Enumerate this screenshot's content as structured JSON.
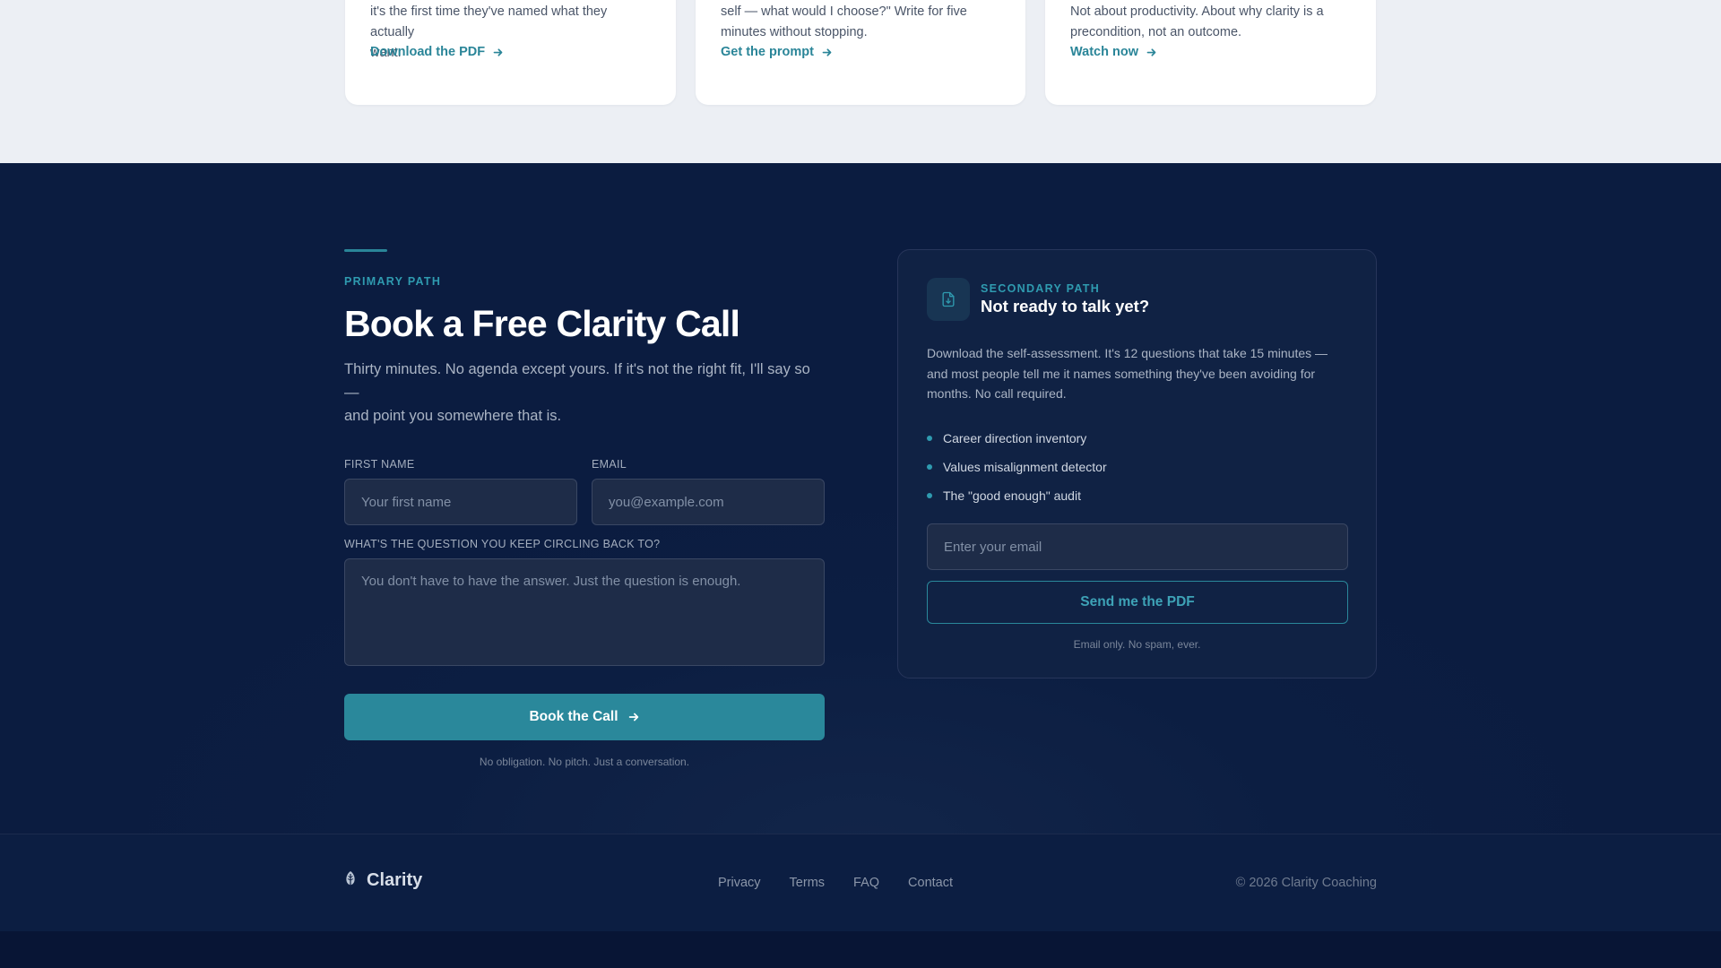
{
  "resources": {
    "cards": [
      {
        "desc_lines": [
          "it's the first time they've named what they actually",
          "want."
        ],
        "link_label": "Download the PDF"
      },
      {
        "desc_lines": [
          "self — what would I choose?\" Write for five",
          "minutes without stopping."
        ],
        "link_label": "Get the prompt"
      },
      {
        "desc_lines": [
          "Not about productivity. About why clarity is a",
          "precondition, not an outcome."
        ],
        "link_label": "Watch now"
      }
    ]
  },
  "primary": {
    "eyebrow": "PRIMARY PATH",
    "headline": "Book a Free Clarity Call",
    "lede_lines": [
      "Thirty minutes. No agenda except yours. If it's not the right fit, I'll say so —",
      "and point you somewhere that is."
    ],
    "first_name_label": "FIRST NAME",
    "first_name_placeholder": "Your first name",
    "first_name_value": "",
    "email_label": "EMAIL",
    "email_placeholder": "you@example.com",
    "email_value": "",
    "question_label": "WHAT'S THE QUESTION YOU KEEP CIRCLING BACK TO?",
    "question_placeholder": "You don't have to have the answer. Just the question is enough.",
    "question_value": "",
    "button_label": "Book the Call",
    "fine_print": "No obligation. No pitch. Just a conversation."
  },
  "secondary": {
    "eyebrow": "SECONDARY PATH",
    "title": "Not ready to talk yet?",
    "icon": "document-download-icon",
    "desc_lines": [
      "Download the self-assessment. It's 12 questions that take 15 minutes —",
      "and most people tell me it names something they've been avoiding for",
      "months. No call required."
    ],
    "items": [
      "Career direction inventory",
      "Values misalignment detector",
      "The \"good enough\" audit"
    ],
    "email_placeholder": "Enter your email",
    "email_value": "",
    "button_label": "Send me the PDF",
    "fine_print": "Email only. No spam, ever."
  },
  "footer": {
    "brand": "Clarity",
    "brand_icon": "leaf-icon",
    "links": [
      "Privacy",
      "Terms",
      "FAQ",
      "Contact"
    ],
    "copyright": "© 2026 Clarity Coaching"
  },
  "colors": {
    "accent": "#2a889b",
    "dark_bg": "#0c1e42",
    "light_bg": "#eceff4"
  }
}
